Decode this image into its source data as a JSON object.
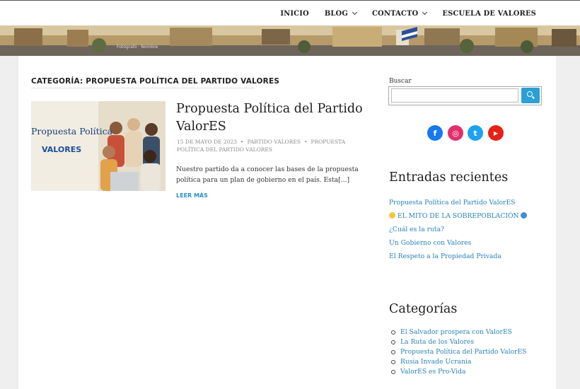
{
  "nav": {
    "items": [
      {
        "label": "INICIO",
        "has_dropdown": false
      },
      {
        "label": "BLOG",
        "has_dropdown": true
      },
      {
        "label": "CONTACTO",
        "has_dropdown": true
      },
      {
        "label": "ESCUELA DE VALORES",
        "has_dropdown": false
      }
    ]
  },
  "banner": {
    "caption": "Fotógrafo · Nombre"
  },
  "archive": {
    "title": "CATEGORÍA: PROPUESTA POLÍTICA DEL PARTIDO VALORES"
  },
  "post": {
    "thumbnail_text": "Propuesta Política",
    "thumbnail_logo": "VALORES",
    "title": "Propuesta Política del Partido ValorES",
    "date": "15 DE MAYO DE 2023",
    "author": "PARTIDO VALORES",
    "category": "PROPUESTA POLÍTICA DEL PARTIDO VALORES",
    "excerpt": "Nuestro partido da a conocer las bases de la propuesta política para un plan de gobierno en el país. Esta[...]",
    "read_more": "LEER MÁS"
  },
  "sidebar": {
    "search_label": "Buscar",
    "search_placeholder": "",
    "social": [
      {
        "name": "facebook-icon",
        "color": "#1877f2",
        "glyph": "f"
      },
      {
        "name": "instagram-icon",
        "color": "#e1306c",
        "glyph": "◎"
      },
      {
        "name": "twitter-icon",
        "color": "#1da1f2",
        "glyph": "t"
      },
      {
        "name": "youtube-icon",
        "color": "#e62117",
        "glyph": "▶"
      }
    ],
    "recent_title": "Entradas recientes",
    "recent": [
      "Propuesta Política del Partido ValorES",
      "EL MITO DE LA SOBREPOBLACIÓN",
      "¿Cuál es la ruta?",
      "Un Gobierno con Valores",
      "El Respeto a la Propiedad Privada"
    ],
    "categories_title": "Categorías",
    "categories": [
      "El Salvador prospera con ValorES",
      "La Ruta de los Valores",
      "Propuesta Política del Partido ValorES",
      "Rusia Invade Ucrania",
      "ValorES es Pro-Vida"
    ]
  }
}
